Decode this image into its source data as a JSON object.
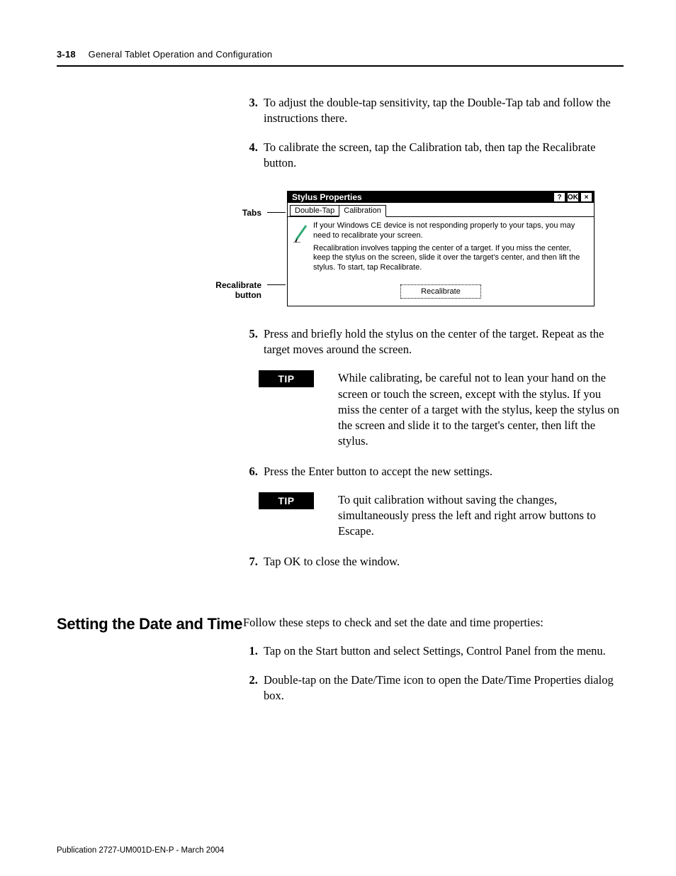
{
  "header": {
    "page_number": "3-18",
    "title": "General Tablet Operation and Configuration"
  },
  "steps_upper": {
    "s3": "To adjust the double-tap sensitivity, tap the Double-Tap tab and follow the instructions there.",
    "s4": "To calibrate the screen, tap the Calibration tab, then tap the Recalibrate button.",
    "s5": "Press and briefly hold the stylus on the center of the target. Repeat as the target moves around the screen.",
    "s6": "Press the Enter button to accept the new settings.",
    "s7": "Tap OK to close the window."
  },
  "callouts": {
    "tabs": "Tabs",
    "recalibrate": "Recalibrate button"
  },
  "window": {
    "title": "Stylus Properties",
    "btn_help": "?",
    "btn_ok": "OK",
    "btn_close": "×",
    "tab1": "Double-Tap",
    "tab2": "Calibration",
    "body_p1": "If your Windows CE device is not responding properly to your taps, you may need to recalibrate your screen.",
    "body_p2": "Recalibration involves tapping the center of a target. If you miss the center, keep the stylus on the screen, slide it over the target's center, and then lift the stylus. To start, tap Recalibrate.",
    "recalibrate_button": "Recalibrate"
  },
  "tips": {
    "badge": "TIP",
    "tip1": "While calibrating, be careful not to lean your hand on the screen or touch the screen, except with the stylus. If you miss the center of a target with the stylus, keep the stylus on the screen and slide it to the target's center, then lift the stylus.",
    "tip2": "To quit calibration without saving the changes, simultaneously press the left and right arrow buttons to Escape."
  },
  "section2": {
    "heading": "Setting the Date and Time",
    "intro": "Follow these steps to check and set the date and time properties:",
    "s1": "Tap on the Start button and select Settings, Control Panel from the menu.",
    "s2": "Double-tap on the Date/Time icon to open the Date/Time Properties dialog box."
  },
  "footer": "Publication 2727-UM001D-EN-P - March 2004"
}
